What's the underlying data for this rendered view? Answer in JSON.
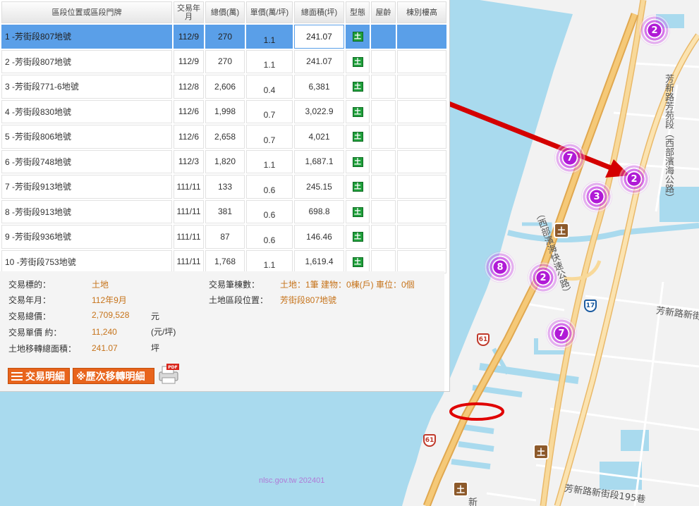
{
  "table": {
    "headers": [
      "區段位置或區段門牌",
      "交易年月",
      "總價(萬)",
      "單價(萬/坪)",
      "總面積(坪)",
      "型態",
      "屋齡",
      "棟別樓高"
    ],
    "rows": [
      {
        "addr": "1  -芳街段807地號",
        "ym": "112/9",
        "total": "270",
        "unit": "1.1",
        "area": "241.07",
        "type": "土"
      },
      {
        "addr": "2  -芳街段807地號",
        "ym": "112/9",
        "total": "270",
        "unit": "1.1",
        "area": "241.07",
        "type": "土"
      },
      {
        "addr": "3  -芳街段771-6地號",
        "ym": "112/8",
        "total": "2,606",
        "unit": "0.4",
        "area": "6,381",
        "type": "土"
      },
      {
        "addr": "4  -芳街段830地號",
        "ym": "112/6",
        "total": "1,998",
        "unit": "0.7",
        "area": "3,022.9",
        "type": "土"
      },
      {
        "addr": "5  -芳街段806地號",
        "ym": "112/6",
        "total": "2,658",
        "unit": "0.7",
        "area": "4,021",
        "type": "土"
      },
      {
        "addr": "6  -芳街段748地號",
        "ym": "112/3",
        "total": "1,820",
        "unit": "1.1",
        "area": "1,687.1",
        "type": "土"
      },
      {
        "addr": "7  -芳街段913地號",
        "ym": "111/11",
        "total": "133",
        "unit": "0.6",
        "area": "245.15",
        "type": "土"
      },
      {
        "addr": "8  -芳街段913地號",
        "ym": "111/11",
        "total": "381",
        "unit": "0.6",
        "area": "698.8",
        "type": "土"
      },
      {
        "addr": "9  -芳街段936地號",
        "ym": "111/11",
        "total": "87",
        "unit": "0.6",
        "area": "146.46",
        "type": "土"
      },
      {
        "addr": "10  -芳街段753地號",
        "ym": "111/11",
        "total": "1,768",
        "unit": "1.1",
        "area": "1,619.4",
        "type": "土"
      }
    ]
  },
  "detail": {
    "target_label": "交易標的：",
    "target_value": "土地",
    "ym_label": "交易年月：",
    "ym_value": "112年9月",
    "total_label": "交易總價：",
    "total_value": "2,709,528",
    "total_unit": "元",
    "unit_label": "交易單價 約：",
    "unit_value": "11,240",
    "unit_unit": "(元/坪)",
    "area_label": "土地移轉總面積：",
    "area_value": "241.07",
    "area_unit": "坪",
    "count_label": "交易筆棟數：",
    "count_value": "土地：1筆 建物：0棟(戶) 車位：0個",
    "location_label": "土地區段位置：",
    "location_value": "芳街段807地號"
  },
  "buttons": {
    "detail": "交易明細",
    "history": "※歷次移轉明細",
    "pdf_badge": "PDF"
  },
  "map": {
    "clusters": [
      "2",
      "7",
      "2",
      "3",
      "8",
      "2",
      "7"
    ],
    "poi_symbol": "土",
    "shield_17": "17",
    "shield_61": "61",
    "road_fangxin_fangyuan": "芳新路芳苑段（西部濱海公路）",
    "road_west_coast": "（西部濱海快速公路）",
    "road_fangxin_xinjie": "芳新路新街段",
    "road_fangxin_xinjie_195": "芳新路新街段195巷",
    "road_xin_fragment": "新",
    "watermark": "nlsc.gov.tw 202401"
  },
  "colors": {
    "selected_row": "#5a9fe8",
    "accent_orange": "#e8641c",
    "value_text": "#c6731a",
    "cluster_purple": "#b01ad6",
    "water": "#a9daee"
  }
}
